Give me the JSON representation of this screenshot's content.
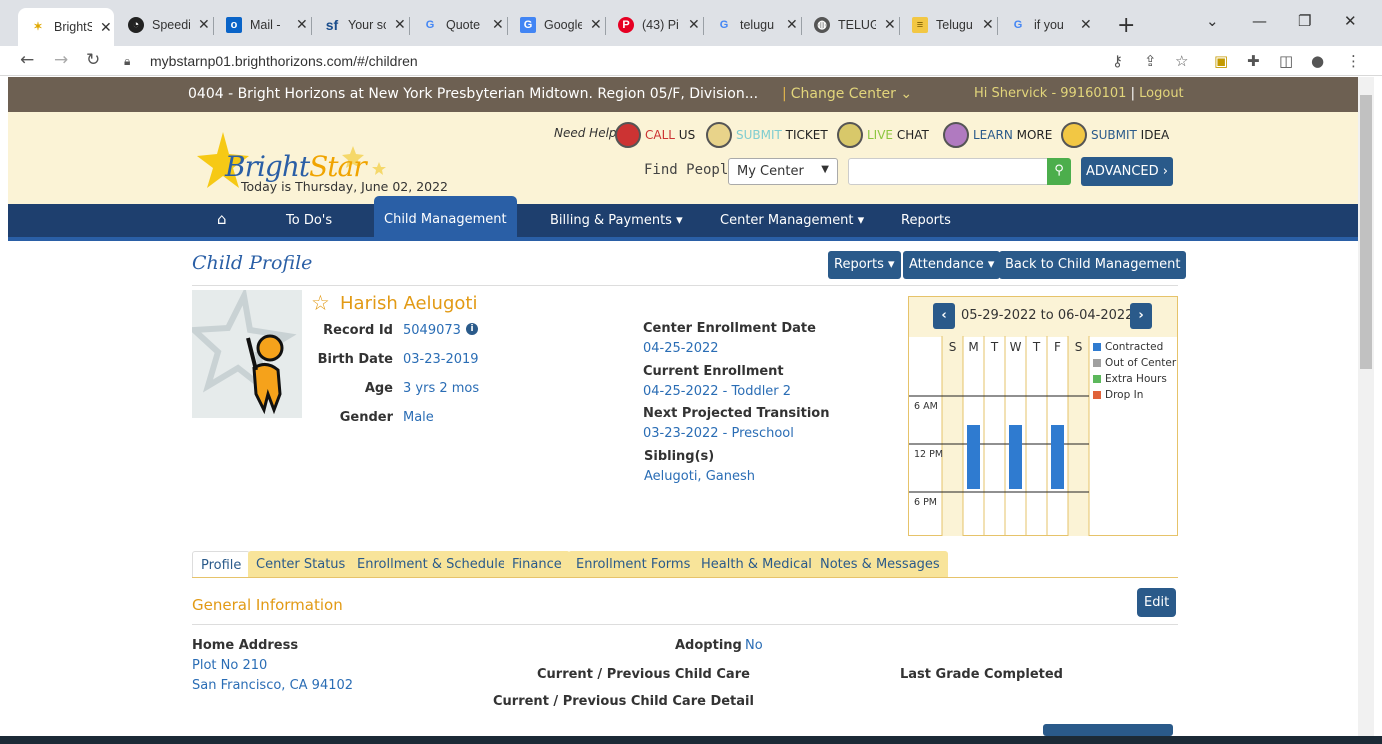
{
  "browser": {
    "tabs": [
      {
        "label": "BrightS",
        "icon": "brightstar-icon",
        "active": true
      },
      {
        "label": "Speedi",
        "icon": "speedometer-icon"
      },
      {
        "label": "Mail -",
        "icon": "outlook-icon"
      },
      {
        "label": "Your sc",
        "icon": "salesforce-icon"
      },
      {
        "label": "Quote",
        "icon": "google-icon"
      },
      {
        "label": "Google",
        "icon": "google-translate-icon"
      },
      {
        "label": "(43) Pi",
        "icon": "pinterest-icon"
      },
      {
        "label": "telugu",
        "icon": "google-icon"
      },
      {
        "label": "TELUG",
        "icon": "globe-icon"
      },
      {
        "label": "Telugu",
        "icon": "document-icon"
      },
      {
        "label": "if you",
        "icon": "google-icon"
      }
    ],
    "url": "mybstarnp01.brighthorizons.com/#/children"
  },
  "topbar": {
    "center_name": "0404 - Bright Horizons at New York Presbyterian Midtown. Region 05/F, Division...",
    "change_center": "Change Center",
    "greeting": "Hi Shervick - 99160101",
    "logout": "Logout"
  },
  "banner": {
    "today": "Today is Thursday, June 02, 2022",
    "need_help": "Need Help?",
    "help_links": [
      {
        "accent": "CALL",
        "rest": " US"
      },
      {
        "accent": "SUBMIT",
        "rest": " TICKET"
      },
      {
        "accent": "LIVE",
        "rest": " CHAT"
      },
      {
        "accent": "LEARN",
        "rest": " MORE"
      },
      {
        "accent": "SUBMIT",
        "rest": " IDEA"
      }
    ],
    "find_people": "Find People",
    "scope_select": "My Center",
    "advanced": "ADVANCED ›"
  },
  "nav": {
    "home": "⌂",
    "items": [
      "To Do's",
      "Child Management",
      "Billing & Payments ▾",
      "Center Management ▾",
      "Reports"
    ]
  },
  "profile": {
    "title": "Child Profile",
    "buttons": [
      "Reports ▾",
      "Attendance ▾",
      "Back to Child Management"
    ],
    "name": "Harish Aelugoti",
    "record_label": "Record Id",
    "record_id": "5049073",
    "birth_label": "Birth Date",
    "birth_date": "03-23-2019",
    "age_label": "Age",
    "age": "3 yrs 2 mos",
    "gender_label": "Gender",
    "gender": "Male",
    "enroll_date_label": "Center Enrollment Date",
    "enroll_date": "04-25-2022",
    "current_enroll_label": "Current Enrollment",
    "current_enroll": "04-25-2022 - Toddler 2",
    "next_label": "Next Projected Transition",
    "next": "03-23-2022 - Preschool",
    "sibling_label": "Sibling(s)",
    "sibling": "Aelugoti, Ganesh"
  },
  "calendar": {
    "range": "05-29-2022 to 06-04-2022",
    "days": [
      "S",
      "M",
      "T",
      "W",
      "T",
      "F",
      "S"
    ],
    "times": [
      "6 AM",
      "12 PM",
      "6 PM"
    ],
    "legend": [
      {
        "label": "Contracted",
        "color": "#2f7bd0"
      },
      {
        "label": "Out of Center",
        "color": "#a0a0a0"
      },
      {
        "label": "Extra Hours",
        "color": "#5cb85c"
      },
      {
        "label": "Drop In",
        "color": "#e0623a"
      }
    ]
  },
  "subtabs": [
    "Profile",
    "Center Status",
    "Enrollment & Schedule",
    "Finance",
    "Enrollment Forms",
    "Health & Medical",
    "Notes & Messages"
  ],
  "general": {
    "heading": "General Information",
    "edit": "Edit",
    "home_address_label": "Home Address",
    "address_line1": "Plot No 210",
    "address_line2": "San Francisco, CA 94102",
    "adopting_label": "Adopting",
    "adopting": "No",
    "child_care_label": "Current / Previous Child Care",
    "child_care_detail_label": "Current / Previous Child Care Detail",
    "last_grade_label": "Last Grade Completed"
  }
}
